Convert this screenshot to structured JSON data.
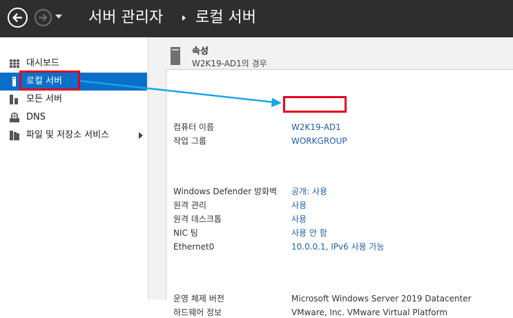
{
  "header": {
    "breadcrumb_root": "서버 관리자",
    "breadcrumb_current": "로컬 서버"
  },
  "sidebar": {
    "items": [
      {
        "label": "대시보드",
        "icon": "dashboard-grid-icon"
      },
      {
        "label": "로컬 서버",
        "icon": "server-icon",
        "selected": true
      },
      {
        "label": "모든 서버",
        "icon": "servers-icon"
      },
      {
        "label": "DNS",
        "icon": "dns-icon"
      },
      {
        "label": "파일 및 저장소 서비스",
        "icon": "file-storage-icon",
        "expandable": true
      }
    ]
  },
  "properties": {
    "title": "속성",
    "subtitle": "W2K19-AD1의 경우",
    "rows": [
      {
        "label": "컴퓨터 이름",
        "value": "W2K19-AD1"
      },
      {
        "label": "작업 그룹",
        "value": "WORKGROUP"
      },
      {
        "label": "Windows Defender 방화벽",
        "value": "공개: 사용"
      },
      {
        "label": "원격 관리",
        "value": "사용"
      },
      {
        "label": "원격 데스크톱",
        "value": "사용"
      },
      {
        "label": "NIC 팀",
        "value": "사용 안 함"
      },
      {
        "label": "Ethernet0",
        "value": "10.0.0.1, IPv6 사용 가능"
      },
      {
        "label": "운영 체제 버전",
        "value": "Microsoft Windows Server 2019 Datacenter"
      },
      {
        "label": "하드웨어 정보",
        "value": "VMware, Inc. VMware Virtual Platform"
      }
    ]
  },
  "colors": {
    "titlebar": "#2e2e2e",
    "selection": "#0a6fc9",
    "link": "#1e5fa8",
    "highlight": "#e3001b",
    "annotation_arrow": "#17a5e6"
  }
}
